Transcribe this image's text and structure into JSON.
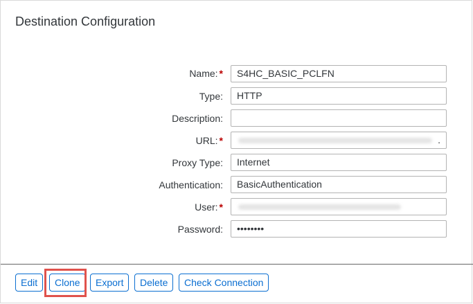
{
  "title": "Destination Configuration",
  "fields": {
    "name": {
      "label": "Name:",
      "required": true,
      "value": "S4HC_BASIC_PCLFN"
    },
    "type": {
      "label": "Type:",
      "required": false,
      "value": "HTTP"
    },
    "description": {
      "label": "Description:",
      "required": false,
      "value": ""
    },
    "url": {
      "label": "URL:",
      "required": true,
      "value": "",
      "trailing": "."
    },
    "proxy_type": {
      "label": "Proxy Type:",
      "required": false,
      "value": "Internet"
    },
    "authentication": {
      "label": "Authentication:",
      "required": false,
      "value": "BasicAuthentication"
    },
    "user": {
      "label": "User:",
      "required": true,
      "value": ""
    },
    "password": {
      "label": "Password:",
      "required": false,
      "value": "••••••••"
    }
  },
  "required_marker": "*",
  "buttons": {
    "edit": "Edit",
    "clone": "Clone",
    "export": "Export",
    "delete": "Delete",
    "check_connection": "Check Connection"
  },
  "colors": {
    "accent": "#0a6ed1",
    "required": "#bb0000",
    "highlight": "#e0524c"
  }
}
